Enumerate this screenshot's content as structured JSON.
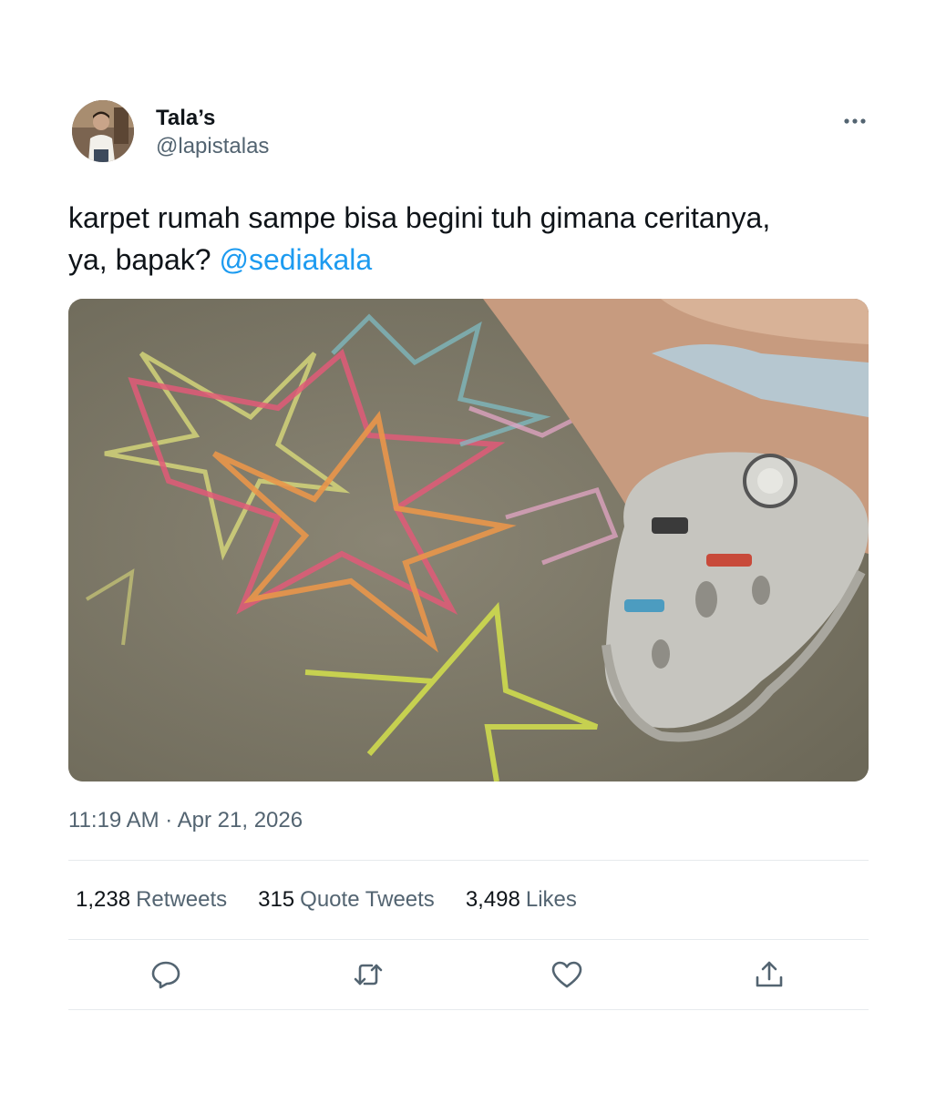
{
  "author": {
    "display_name": "Tala’s",
    "handle": "@lapistalas"
  },
  "tweet": {
    "text": "karpet rumah sampe bisa begini tuh gimana ceritanya, ya, bapak?",
    "mention": "@sediakala",
    "time": "11:19 AM",
    "separator": "·",
    "date": "Apr 21, 2026",
    "media_description_icon": "photo"
  },
  "stats": {
    "retweets_count": "1,238",
    "retweets_label": "Retweets",
    "quotes_count": "315",
    "quotes_label": "Quote Tweets",
    "likes_count": "3,498",
    "likes_label": "Likes"
  },
  "icons": {
    "more": "more-icon",
    "reply": "reply-icon",
    "retweet": "retweet-icon",
    "like": "like-icon",
    "share": "share-icon"
  },
  "colors": {
    "text": "#0f1419",
    "secondary": "#536471",
    "link": "#1d9bf0",
    "divider": "#e6eaed"
  }
}
